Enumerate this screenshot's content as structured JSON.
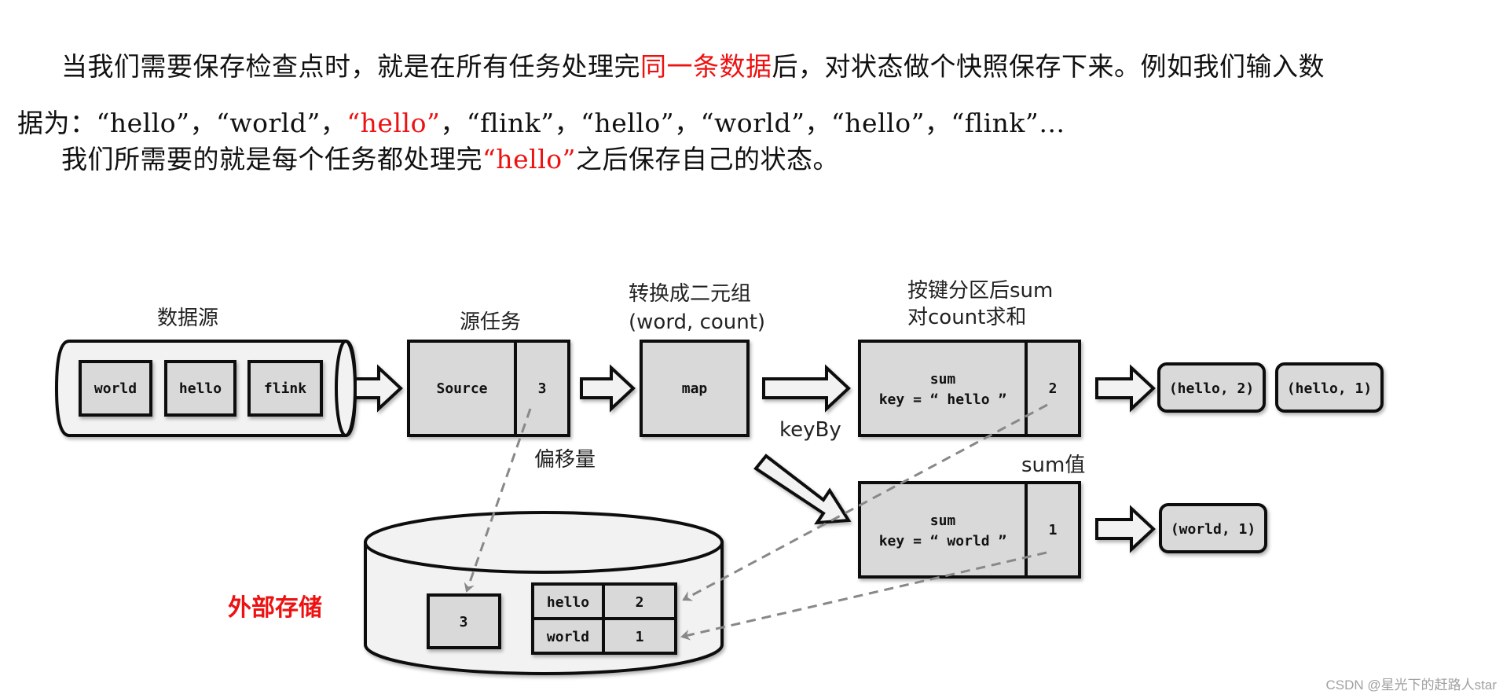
{
  "text": {
    "para1_a": "当我们需要保存检查点时，就是在所有任务处理完",
    "para1_red": "同一条数据",
    "para1_b": "后，对状态做个快照保存下来。例如我们输入数",
    "para2_a": "据为：“hello”，“world”，",
    "para2_red": "“hello”",
    "para2_b": "，“flink”，“hello”，“world”，“hello”，“flink”…",
    "para3_a": "我们所需要的就是每个任务都处理完",
    "para3_red": "“hello”",
    "para3_b": "之后保存自己的状态。"
  },
  "diagram": {
    "data_source": {
      "label": "数据源",
      "items": [
        "world",
        "hello",
        "flink"
      ]
    },
    "source_task": {
      "label": "源任务",
      "name": "Source",
      "offset": "3"
    },
    "map_task": {
      "label_line1": "转换成二元组",
      "label_line2": "(word, count)",
      "name": "map"
    },
    "keyby_label": "keyBy",
    "offset_label": "偏移量",
    "sum_tasks": {
      "label_line1": "按键分区后sum",
      "label_line2": "对count求和",
      "sum_value_label": "sum值",
      "hello": {
        "name": "sum",
        "key": "key = “ hello ”",
        "value": "2"
      },
      "world": {
        "name": "sum",
        "key": "key = “ world ”",
        "value": "1"
      }
    },
    "outputs_hello": [
      "(hello, 2)",
      "(hello, 1)"
    ],
    "outputs_world": [
      "(world, 1)"
    ],
    "storage": {
      "label": "外部存储",
      "offset": "3",
      "rows": [
        {
          "key": "hello",
          "value": "2"
        },
        {
          "key": "world",
          "value": "1"
        }
      ]
    }
  },
  "watermark": "CSDN @星光下的赶路人star"
}
